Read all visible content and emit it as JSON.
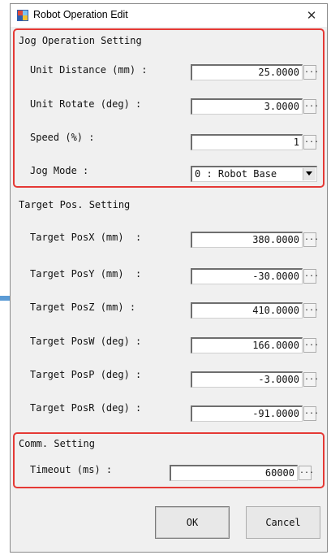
{
  "window": {
    "title": "Robot Operation Edit"
  },
  "jog_operation": {
    "title": "Jog Operation Setting",
    "fields": [
      {
        "label": "Unit Distance (mm) :",
        "value": "25.0000"
      },
      {
        "label": "Unit Rotate (deg) :",
        "value": "3.0000"
      },
      {
        "label": "Speed (%) :",
        "value": "1"
      }
    ],
    "jog_mode": {
      "label": "Jog Mode :",
      "value": "0 : Robot Base"
    }
  },
  "target_pos": {
    "title": "Target Pos. Setting",
    "fields": [
      {
        "label": "Target PosX (mm)  :",
        "value": "380.0000"
      },
      {
        "label": "Target PosY (mm)  :",
        "value": "-30.0000"
      },
      {
        "label": "Target PosZ (mm) :",
        "value": "410.0000"
      },
      {
        "label": "Target PosW (deg) :",
        "value": "166.0000"
      },
      {
        "label": "Target PosP (deg) :",
        "value": "-3.0000"
      },
      {
        "label": "Target PosR (deg) :",
        "value": "-91.0000"
      }
    ]
  },
  "comm": {
    "title": "Comm. Setting",
    "timeout": {
      "label": "Timeout (ms) :",
      "value": "60000"
    }
  },
  "buttons": {
    "ok": "OK",
    "cancel": "Cancel"
  },
  "browse_label": "...",
  "colors": {
    "highlight": "#e53935",
    "arrow": "#5b9bd5"
  },
  "icons": {
    "app": "robot-app-icon",
    "close": "close-icon",
    "dropdown": "chevron-down-icon",
    "pointer": "arrow-right-icon"
  }
}
